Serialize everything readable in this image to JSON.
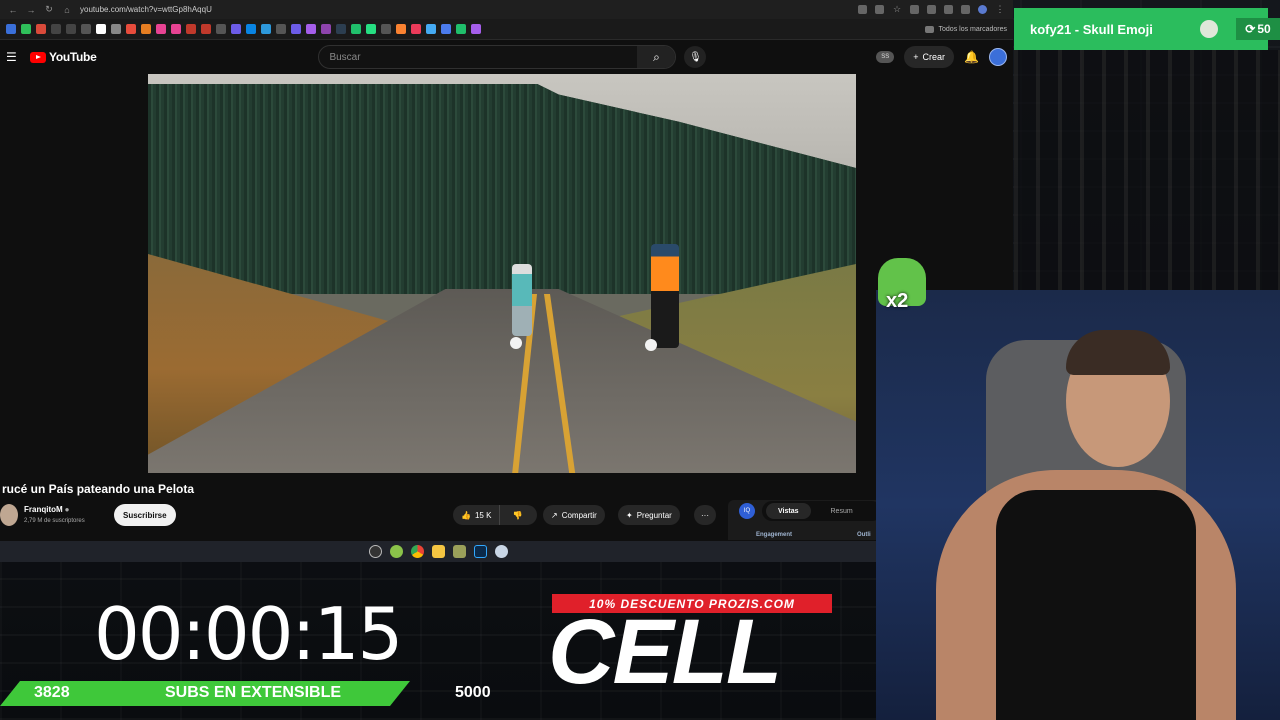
{
  "browser": {
    "url": "youtube.com/watch?v=wttGp8hAqqU",
    "bookmarks_label": "Todos los marcadores"
  },
  "youtube": {
    "logo": "YouTube",
    "search_placeholder": "Buscar",
    "ss_badge": "SS",
    "create_label": "Crear"
  },
  "video": {
    "title": "rucé un País pateando una Pelota",
    "channel": "FranqitoM",
    "subscribers": "2,79 M de suscriptores",
    "subscribe_label": "Suscribirse",
    "likes": "15 K",
    "share_label": "Compartir",
    "ask_label": "Preguntar",
    "more_label": "···"
  },
  "extension": {
    "icon_label": "IQ",
    "tab_active": "Vistas",
    "tab_other": "Resum",
    "sub_left": "Engagement",
    "sub_right": "Outli"
  },
  "alert": {
    "text": "kofy21 - Skull Emoji",
    "points": "50"
  },
  "overlay": {
    "emote_multiplier": "x2",
    "timer": "00:00:15",
    "subs_current": "3828",
    "subs_label": "SUBS EN EXTENSIBLE",
    "subs_goal": "5000",
    "promo": "10% DESCUENTO PROZIS.COM",
    "cell": "CELL"
  }
}
